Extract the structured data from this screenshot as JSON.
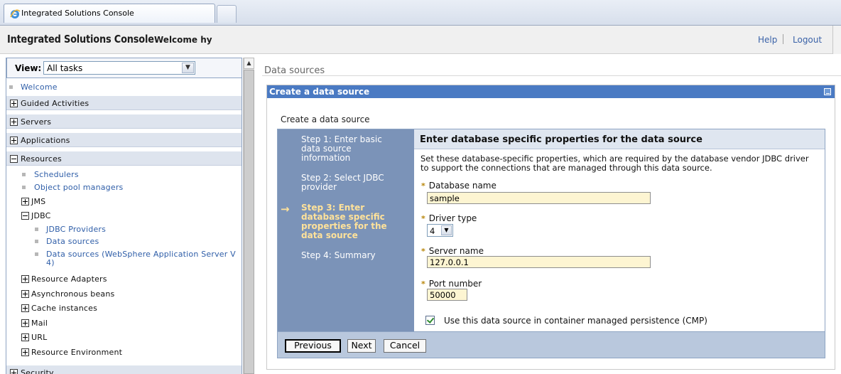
{
  "browser": {
    "tab_title": "Integrated Solutions Console"
  },
  "header": {
    "app_title": "Integrated Solutions Console",
    "welcome": "Welcome hy",
    "help": "Help",
    "logout": "Logout"
  },
  "nav": {
    "view_label": "View:",
    "view_value": "All tasks",
    "items": {
      "welcome": "Welcome",
      "guided": "Guided Activities",
      "servers": "Servers",
      "applications": "Applications",
      "resources": "Resources",
      "schedulers": "Schedulers",
      "object_pool": "Object pool managers",
      "jms": "JMS",
      "jdbc": "JDBC",
      "jdbc_providers": "JDBC Providers",
      "data_sources": "Data sources",
      "data_sources_v4_line1": "Data sources (WebSphere Application Server V",
      "data_sources_v4_line2": "4)",
      "resource_adapters": "Resource Adapters",
      "async_beans": "Asynchronous beans",
      "cache": "Cache instances",
      "mail": "Mail",
      "url": "URL",
      "resource_env": "Resource Environment",
      "security": "Security"
    }
  },
  "content": {
    "breadcrumb": "Data sources",
    "portlet_title": "Create a data source",
    "wizard_heading": "Create a data source",
    "steps": {
      "s1_l1": "Step 1: Enter basic",
      "s1_l2": "data source",
      "s1_l3": "information",
      "s2_l1": "Step 2: Select JDBC",
      "s2_l2": "provider",
      "s3_l1": "Step 3: Enter",
      "s3_l2": "database specific",
      "s3_l3": "properties for the",
      "s3_l4": "data source",
      "s4_l1": "Step 4: Summary",
      "arrow": "→"
    },
    "form": {
      "title": "Enter database specific properties for the data source",
      "desc_l1": "Set these database-specific properties, which are required by the database vendor JDBC driver",
      "desc_l2": "to support the connections that are managed through this data source.",
      "required_marker": "*",
      "db_name_label": "Database name",
      "db_name_value": "sample",
      "driver_type_label": "Driver type",
      "driver_type_value": "4",
      "server_name_label": "Server name",
      "server_name_value": "127.0.0.1",
      "port_label": "Port number",
      "port_value": "50000",
      "cmp_checked": true,
      "cmp_label": "Use this data source in container managed persistence (CMP)"
    },
    "buttons": {
      "previous": "Previous",
      "next": "Next",
      "cancel": "Cancel"
    }
  },
  "colors": {
    "title_bar": "#4a7ac3",
    "step_panel": "#7b93b8",
    "current_step": "#ffe29a",
    "field_bg": "#fdf5d2",
    "link": "#2f5ea8"
  },
  "icons": [
    "ie-icon",
    "plus-icon",
    "minus-icon",
    "chevron-down-icon",
    "arrow-right-icon",
    "checkbox-checked-icon",
    "minimize-icon"
  ]
}
